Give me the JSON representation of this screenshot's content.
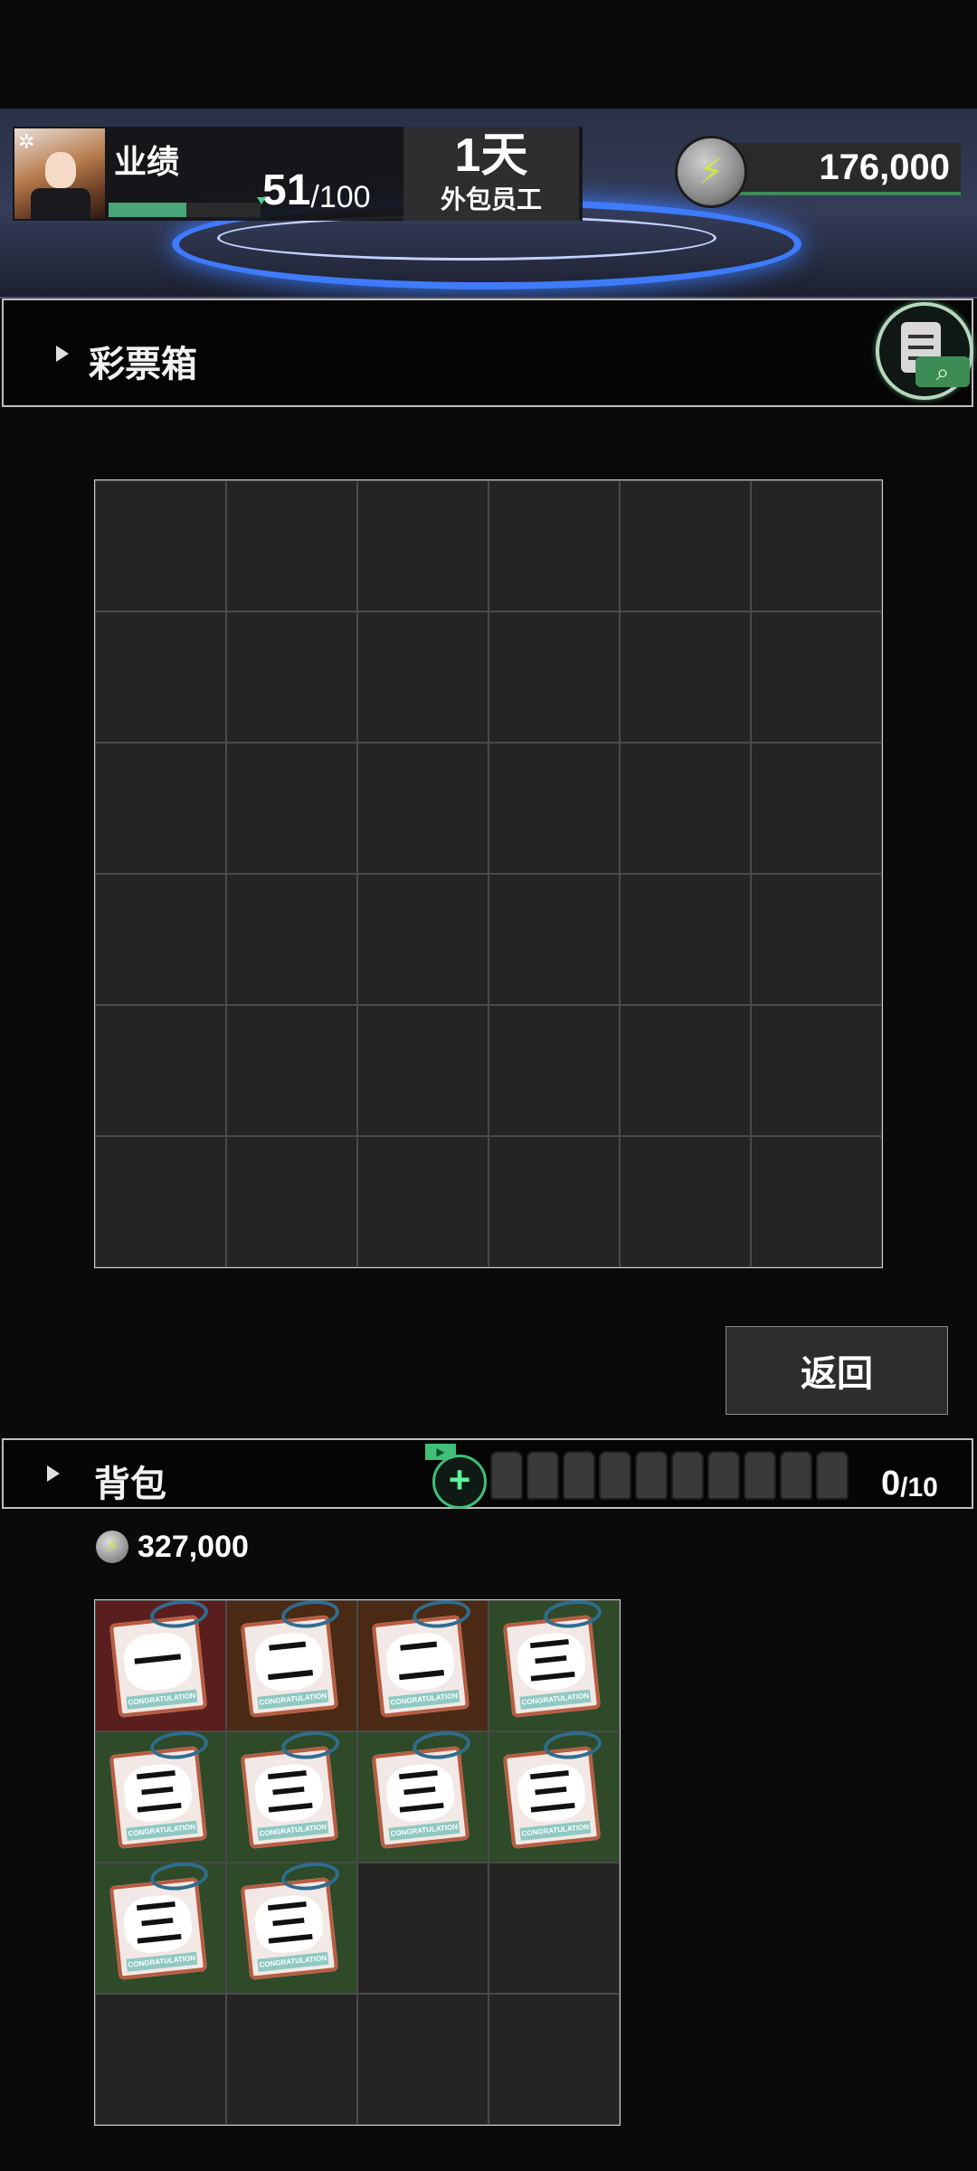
{
  "hud": {
    "performance_label": "业绩",
    "performance_current": "51",
    "performance_separator": "/",
    "performance_max": "100",
    "performance_fraction": 0.51,
    "day": "1天",
    "role": "外包员工",
    "coins": "176,000",
    "icons": [
      "gear-icon",
      "avatar",
      "coin-icon"
    ]
  },
  "lottery": {
    "title": "彩票箱",
    "rows": 6,
    "cols": 6,
    "back_label": "返回",
    "icons": [
      "triangle-icon",
      "clipboard-search-icon"
    ]
  },
  "bag": {
    "title": "背包",
    "slot_count": 10,
    "count_current": "0",
    "count_separator": "/",
    "count_max": "10",
    "coin_value": "327,000",
    "rows": 4,
    "cols": 4,
    "ticket_caption": "CONGRATULATION",
    "items": [
      {
        "glyph": "一",
        "bg": "#5a1e1e"
      },
      {
        "glyph": "二",
        "bg": "#4a2a14"
      },
      {
        "glyph": "二",
        "bg": "#4a2a14"
      },
      {
        "glyph": "三",
        "bg": "#2e4a28"
      },
      {
        "glyph": "三",
        "bg": "#2e4a28"
      },
      {
        "glyph": "三",
        "bg": "#2e4a28"
      },
      {
        "glyph": "三",
        "bg": "#2e4a28"
      },
      {
        "glyph": "三",
        "bg": "#2e4a28"
      },
      {
        "glyph": "三",
        "bg": "#2e4a28"
      },
      {
        "glyph": "三",
        "bg": "#2e4a28"
      }
    ]
  },
  "colors": {
    "accent_green": "#3fbf78",
    "progress_green": "#4aa57a",
    "ring_blue": "#3f7bff"
  }
}
